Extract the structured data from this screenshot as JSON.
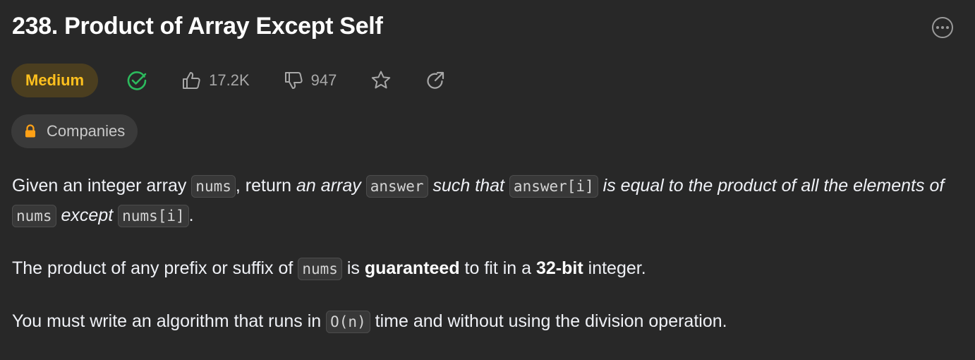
{
  "problem": {
    "title": "238. Product of Array Except Self",
    "difficulty": "Medium",
    "likes": "17.2K",
    "dislikes": "947",
    "companies_label": "Companies"
  },
  "description": {
    "p1": {
      "t1": "Given an integer array ",
      "c1": "nums",
      "t2": ", return ",
      "e1": "an array",
      "c2": "answer",
      "e2": "such that",
      "c3": "answer[i]",
      "e3": "is equal to the product of all the elements of",
      "c4": "nums",
      "e4": "except",
      "c5": "nums[i]",
      "t3": "."
    },
    "p2": {
      "t1": "The product of any prefix or suffix of ",
      "c1": "nums",
      "t2": " is ",
      "b1": "guaranteed",
      "t3": " to fit in a ",
      "b2": "32-bit",
      "t4": " integer."
    },
    "p3": {
      "t1": "You must write an algorithm that runs in ",
      "c1": "O(n)",
      "t2": " time and without using the division operation."
    }
  },
  "icons": {
    "solved": "check-circle-icon",
    "like": "thumbs-up-icon",
    "dislike": "thumbs-down-icon",
    "favorite": "star-icon",
    "share": "share-icon",
    "lock": "lock-icon",
    "more": "more-options-icon"
  },
  "colors": {
    "background": "#282828",
    "difficulty_medium": "#ffc01e",
    "difficulty_bg": "#4b3e1f",
    "solved_green": "#2cbb5d",
    "lock_orange": "#ffa116"
  }
}
